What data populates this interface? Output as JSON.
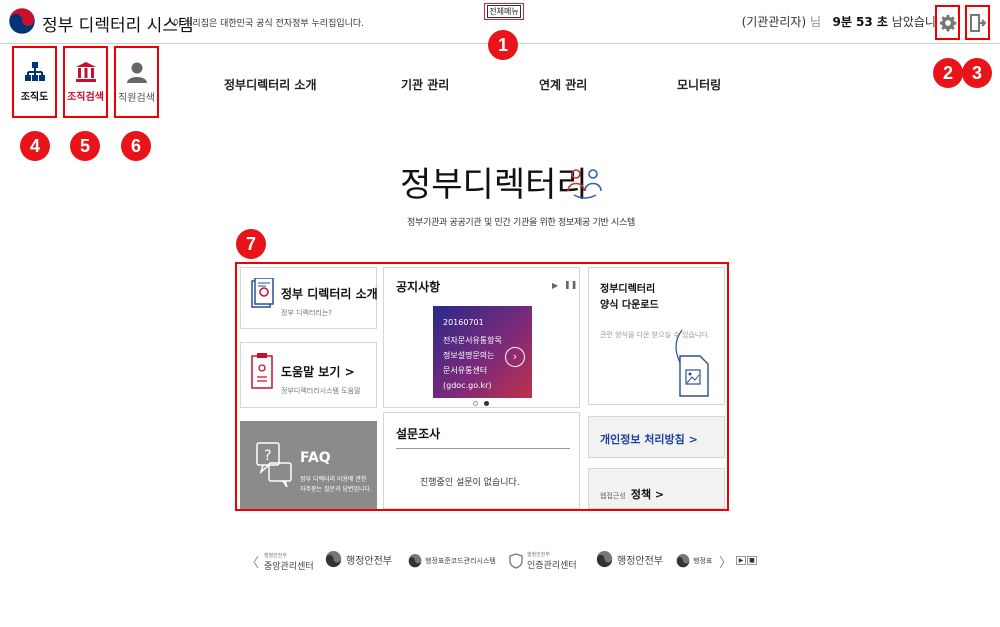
{
  "header": {
    "site_title": "정부 디렉터리 시스템",
    "tagline": "이 누리집은 대한민국 공식 전자정부 누리집입니다.",
    "all_menu_label": "전체메뉴",
    "user_role": "(기관관리자)",
    "user_suffix": "님",
    "session_time": "9분 53 초",
    "session_suffix": "남았습니다"
  },
  "quick_links": [
    {
      "label": "조직도",
      "icon": "org-chart-icon"
    },
    {
      "label": "조직검색",
      "icon": "government-building-icon"
    },
    {
      "label": "직원검색",
      "icon": "person-icon"
    }
  ],
  "nav": {
    "items": [
      "정부디렉터리 소개",
      "기관 관리",
      "연계 관리",
      "모니터링"
    ]
  },
  "markers": [
    "1",
    "2",
    "3",
    "4",
    "5",
    "6",
    "7"
  ],
  "hero": {
    "title": "정부디렉터리",
    "subtitle": "정부기관과 공공기관 및 민간 기관을 위한 정보제공 기반 시스템"
  },
  "cards": {
    "intro": {
      "title": "정부 디렉터리 소개",
      "chev": ">",
      "desc": "정부 디렉터리는?"
    },
    "help": {
      "title": "도움말 보기",
      "chev": ">",
      "desc": "정부디렉터리시스템 도움말"
    },
    "faq": {
      "title": "FAQ",
      "desc1": "정부 디렉터리 이용에 관한",
      "desc2": "자주묻는 질문과 답변입니다."
    },
    "notice": {
      "title": "공지사항",
      "lines": [
        "20160701",
        "전자문서유통항목",
        "정보설명문의는",
        "문서유통센터",
        "(gdoc.go.kr)"
      ]
    },
    "survey": {
      "title": "설문조사",
      "empty": "진행중인 설문이 없습니다."
    },
    "download": {
      "title1": "정부디렉터리",
      "title2": "양식 다운로드",
      "desc": "관련 양식을 다운 받으실 수 있습니다."
    },
    "privacy": {
      "label": "개인정보 처리방침 >"
    },
    "email": {
      "prefix": "웹접근성",
      "label": "정책 >"
    }
  },
  "banners": [
    {
      "small": "행정안전부",
      "label": "중앙관리센터"
    },
    {
      "small": "",
      "label": "행정안전부"
    },
    {
      "small": "",
      "label": "행정표준코드관리시스템"
    },
    {
      "small": "행정안전부",
      "label": "인증관리센터"
    },
    {
      "small": "",
      "label": "행정안전부"
    },
    {
      "small": "",
      "label": "행정표"
    }
  ],
  "banner_nav": {
    "prev": "〈",
    "next": "〉"
  },
  "colors": {
    "accent_red": "#e8141a",
    "gov_red": "#c8102e",
    "gov_blue": "#003478",
    "link_blue": "#1a3fa0"
  }
}
